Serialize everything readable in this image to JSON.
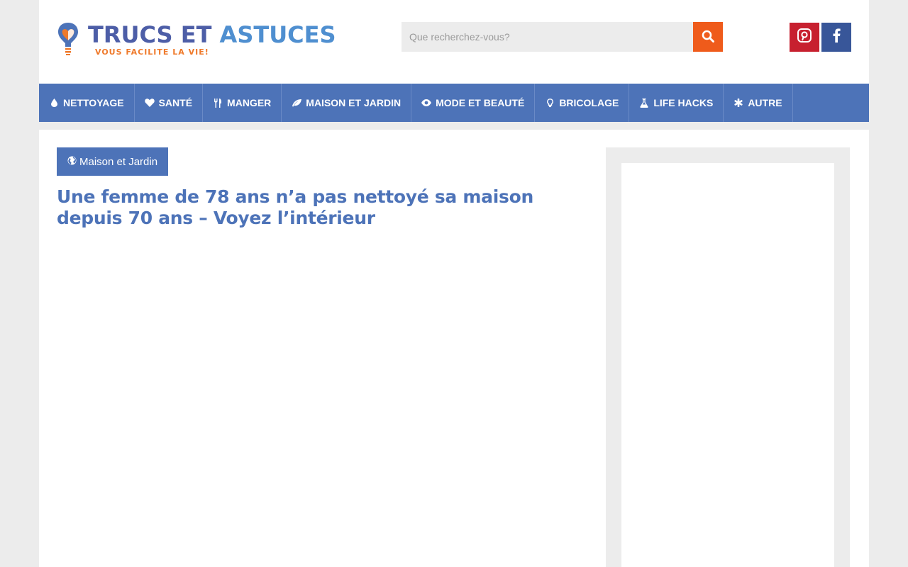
{
  "header": {
    "logo": {
      "title_part1": "TRUCS ET",
      "title_part2": "ASTUCES",
      "tagline": "VOUS FACILITE LA VIE!"
    },
    "search": {
      "placeholder": "Que recherchez-vous?",
      "value": "",
      "button_icon": "search-icon"
    },
    "social": [
      {
        "name": "pinterest",
        "icon": "pinterest-icon",
        "color": "#c7202f"
      },
      {
        "name": "facebook",
        "icon": "facebook-icon",
        "color": "#385699"
      }
    ]
  },
  "nav": {
    "items": [
      {
        "label": "NETTOYAGE",
        "icon": "drop-icon"
      },
      {
        "label": "SANTÉ",
        "icon": "heart-icon"
      },
      {
        "label": "MANGER",
        "icon": "cutlery-icon"
      },
      {
        "label": "MAISON ET JARDIN",
        "icon": "leaf-icon"
      },
      {
        "label": "MODE ET BEAUTÉ",
        "icon": "eye-icon"
      },
      {
        "label": "BRICOLAGE",
        "icon": "lightbulb-icon"
      },
      {
        "label": "LIFE HACKS",
        "icon": "flask-icon"
      },
      {
        "label": "AUTRE",
        "icon": "asterisk-icon"
      }
    ]
  },
  "article": {
    "category": "Maison et Jardin",
    "category_icon": "globe-icon",
    "title": "Une femme de 78 ans n’a pas nettoyé sa maison depuis 70 ans – Voyez l’intérieur"
  },
  "colors": {
    "brand_blue": "#4d73b8",
    "logo_orange": "#ef7a2b",
    "search_orange": "#ef5b1b",
    "page_bg": "#ececec"
  }
}
